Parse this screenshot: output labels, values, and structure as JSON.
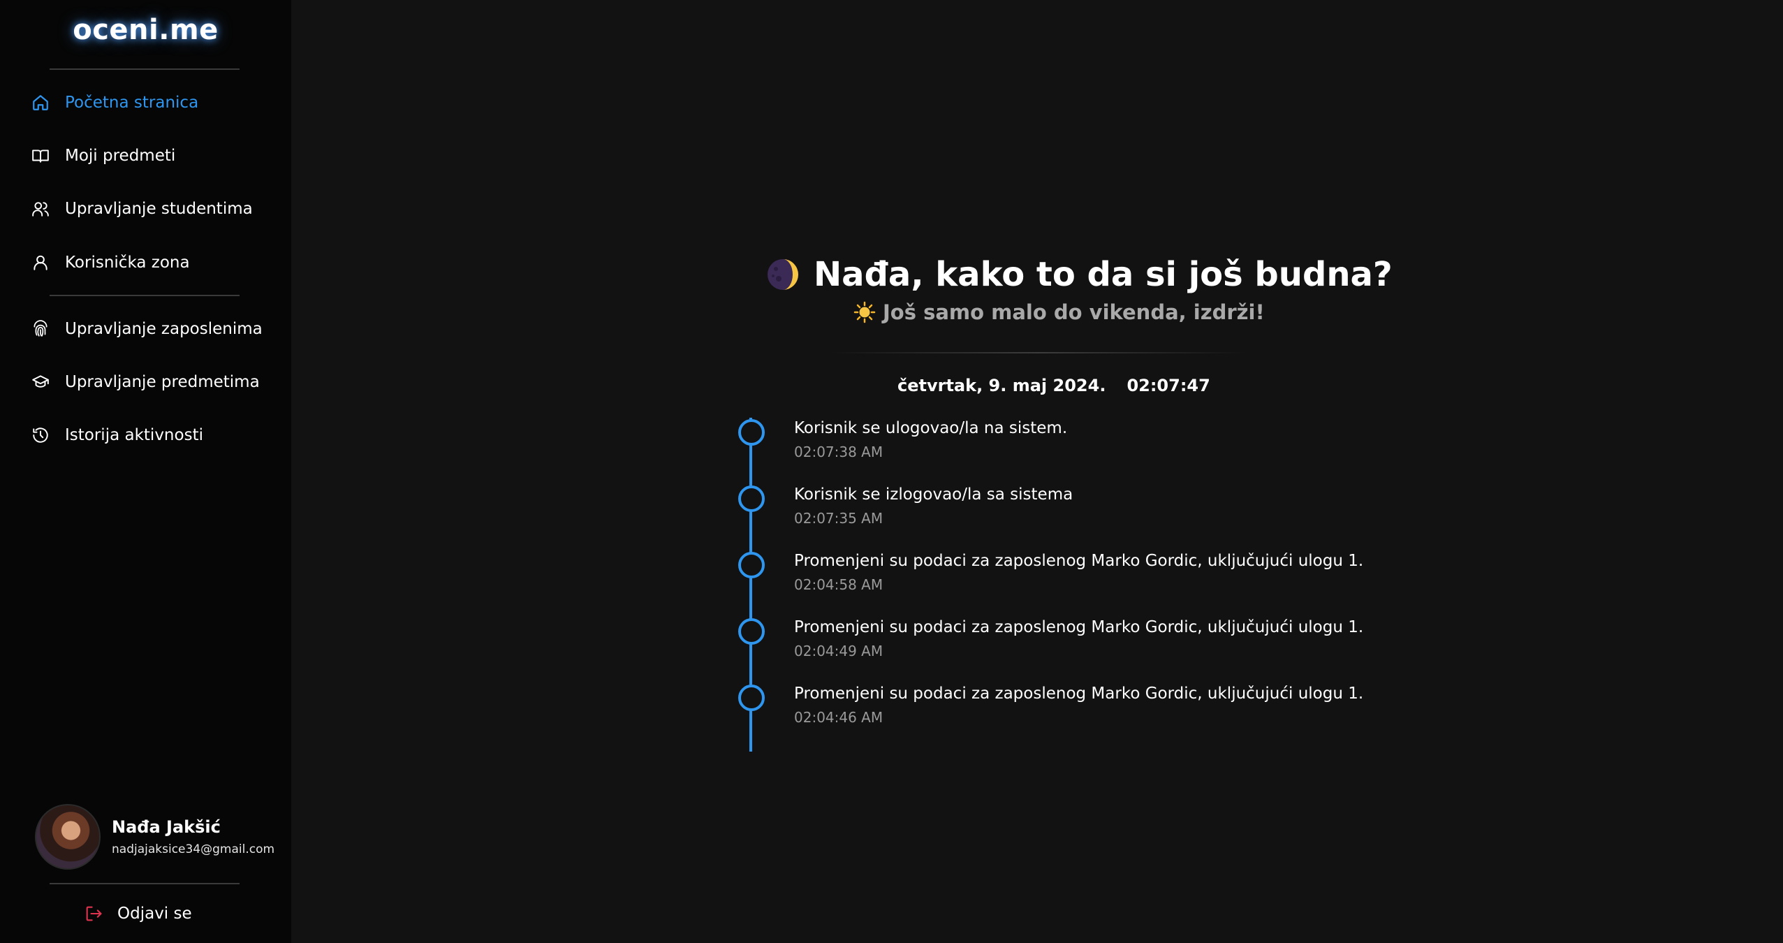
{
  "app": {
    "logo": "oceni.me"
  },
  "sidebar": {
    "items": [
      {
        "label": "Početna stranica",
        "icon": "home-icon",
        "active": true
      },
      {
        "label": "Moji predmeti",
        "icon": "book-icon",
        "active": false
      },
      {
        "label": "Upravljanje studentima",
        "icon": "users-icon",
        "active": false
      },
      {
        "label": "Korisnička zona",
        "icon": "user-icon",
        "active": false
      },
      {
        "label": "Upravljanje zaposlenima",
        "icon": "fingerprint-icon",
        "active": false
      },
      {
        "label": "Upravljanje predmetima",
        "icon": "graduation-cap-icon",
        "active": false
      },
      {
        "label": "Istorija aktivnosti",
        "icon": "history-icon",
        "active": false
      }
    ],
    "user": {
      "name": "Nađa Jakšić",
      "email": "nadjajaksice34@gmail.com"
    },
    "logout_label": "Odjavi se"
  },
  "main": {
    "greeting_title": "Nađa, kako to da si još budna?",
    "subtitle": "Još samo malo do vikenda, izdrži!",
    "date": "četvrtak, 9. maj 2024.",
    "time": "02:07:47",
    "activity": [
      {
        "text": "Korisnik se ulogovao/la na sistem.",
        "time": "02:07:38 AM"
      },
      {
        "text": "Korisnik se izlogovao/la sa sistema",
        "time": "02:07:35 AM"
      },
      {
        "text": "Promenjeni su podaci za zaposlenog Marko Gordic, uključujući ulogu 1.",
        "time": "02:04:58 AM"
      },
      {
        "text": "Promenjeni su podaci za zaposlenog Marko Gordic, uključujući ulogu 1.",
        "time": "02:04:49 AM"
      },
      {
        "text": "Promenjeni su podaci za zaposlenog Marko Gordic, uključujući ulogu 1.",
        "time": "02:04:46 AM"
      }
    ]
  },
  "colors": {
    "accent": "#2f96f0",
    "background": "#121212",
    "sidebar": "#060606",
    "logout_icon": "#e0334f"
  }
}
